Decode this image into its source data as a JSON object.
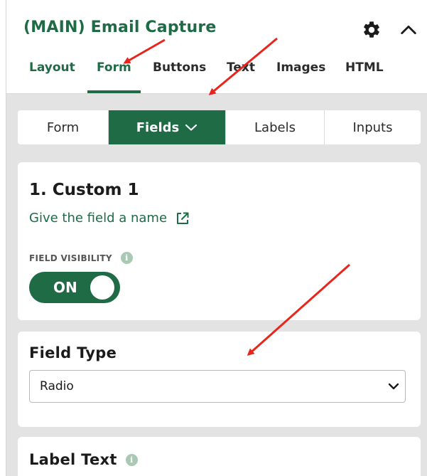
{
  "header": {
    "title": "(MAIN) Email Capture",
    "settings_icon": "gear-icon",
    "collapse_icon": "chevron-up-icon"
  },
  "tabs": [
    {
      "label": "Layout"
    },
    {
      "label": "Form"
    },
    {
      "label": "Buttons"
    },
    {
      "label": "Text"
    },
    {
      "label": "Images"
    },
    {
      "label": "HTML"
    }
  ],
  "active_tab": "Form",
  "subtabs": [
    {
      "label": "Form"
    },
    {
      "label": "Fields"
    },
    {
      "label": "Labels"
    },
    {
      "label": "Inputs"
    }
  ],
  "active_subtab": "Fields",
  "field_card": {
    "title": "1. Custom 1",
    "link_text": "Give the field a name",
    "visibility_label": "FIELD VISIBILITY",
    "info_glyph": "i",
    "toggle_label": "ON",
    "toggle_state": true
  },
  "field_type": {
    "title": "Field Type",
    "selected_value": "Radio"
  },
  "label_text": {
    "title": "Label Text",
    "info_glyph": "i"
  },
  "colors": {
    "brand_green": "#1e6b46",
    "annotation_red": "#e8251c",
    "panel_bg": "#e3e3e3"
  }
}
